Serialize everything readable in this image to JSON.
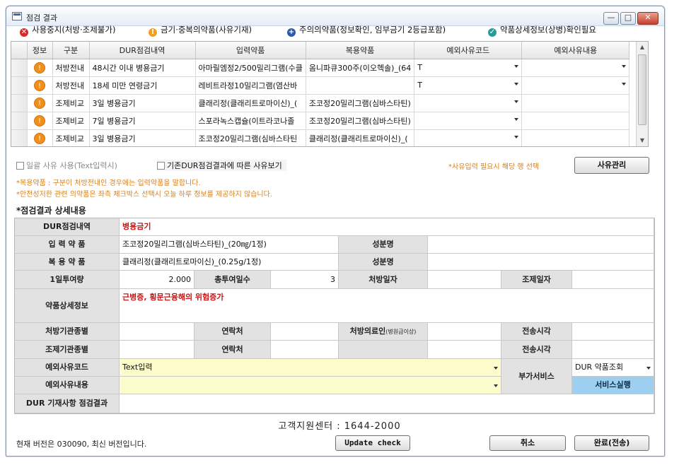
{
  "window": {
    "title": "점검 결과",
    "minimize": "—",
    "maximize": "□",
    "close": "✕"
  },
  "legend": [
    {
      "icon": "stop-icon",
      "glyph": "✕",
      "color": "#d8282a",
      "label": "사용중지(처방·조제불가)"
    },
    {
      "icon": "warning-icon",
      "glyph": "!",
      "color": "#f0a020",
      "label": "금기·중복의약품(사유기재)"
    },
    {
      "icon": "plus-icon",
      "glyph": "+",
      "color": "#2a5ab0",
      "label": "주의의약품(정보확인, 임부금기 2등급포함)"
    },
    {
      "icon": "check-icon",
      "glyph": "✓",
      "color": "#2a9a9a",
      "label": "약품상세정보(상병)확인필요"
    }
  ],
  "grid": {
    "headers": [
      "정보",
      "구분",
      "DUR점검내역",
      "입력약품",
      "복용약품",
      "예외사유코드",
      "예외사유내용"
    ],
    "rows": [
      {
        "type": "처방전내",
        "dur": "48시간 이내 병용금기",
        "input": "아마릴엠정2/500밀리그램(수클",
        "taking": "옴니파큐300주(이오헥솔)_(64",
        "code": "T",
        "reason": ""
      },
      {
        "type": "처방전내",
        "dur": "18세 미만 연령금기",
        "input": "레비트라정10밀리그램(염산바",
        "taking": "",
        "code": "T",
        "reason": ""
      },
      {
        "type": "조제비교",
        "dur": "3일 병용금기",
        "input": "클래리정(클래리트로마이신)_(",
        "taking": "조코정20밀리그램(심바스타틴)",
        "code": "",
        "reason": ""
      },
      {
        "type": "조제비교",
        "dur": "7일 병용금기",
        "input": "스포라녹스캡슐(이트라코나졸",
        "taking": "조코정20밀리그램(심바스타틴)",
        "code": "",
        "reason": ""
      },
      {
        "type": "조제비교",
        "dur": "3일 병용금기",
        "input": "조코정20밀리그램(심바스타틴",
        "taking": "클래리정(클래리트로마이신)_(",
        "code": "",
        "reason": ""
      }
    ]
  },
  "options": {
    "bulk_reason": "일괄 사유 사용(Text입력시)",
    "prev_reason": "기존DUR점검결과에 따른 사유보기",
    "hint": "*사유입력 필요시 해당 행 선택",
    "manage_button": "사유관리"
  },
  "notes": [
    "*복용약품 : 구분이 처방전내인 경우에는 입력약품을 말합니다.",
    "*안전성저한 관련 의약품은 좌측 체크박스 선택시 오늘 하루 정보를 제공하지 않습니다."
  ],
  "detail": {
    "section_title": "*점검결과 상세내용",
    "dur_label": "DUR점검내역",
    "dur_value": "병용금기",
    "input_label": "입 력 약 품",
    "input_value": "조코정20밀리그램(심바스타틴)_(20㎎/1정)",
    "ingredient_label": "성분명",
    "ingredient_value": "",
    "taking_label": "복 용 약 품",
    "taking_value": "클래리정(클래리트로마이신)_(0.25g/1정)",
    "ingredient2_label": "성분명",
    "ingredient2_value": "",
    "daily_label": "1일투여량",
    "daily_value": "2.000",
    "total_days_label": "총투여일수",
    "total_days_value": "3",
    "rx_date_label": "처방일자",
    "rx_date_value": "",
    "dispense_date_label": "조제일자",
    "dispense_date_value": "",
    "drug_info_label": "약품상세정보",
    "drug_info_value": "근병증, 횡문근융해의 위험증가",
    "rx_org_label": "처방기관종별",
    "rx_org_value": "",
    "contact_label": "연락처",
    "contact_value": "",
    "rx_doctor_label": "처방의료인",
    "rx_doctor_sub": "(병원급이상)",
    "rx_doctor_value": "",
    "send_time_label": "전송시각",
    "send_time_value": "",
    "dispense_org_label": "조제기관종별",
    "dispense_org_value": "",
    "contact2_label": "연락처",
    "contact2_value": "",
    "blank_value": "",
    "send_time2_label": "전송시각",
    "send_time2_value": "",
    "exc_code_label": "예외사유코드",
    "exc_code_value": "Text입력",
    "exc_reason_label": "예외사유내용",
    "exc_reason_value": "",
    "addon_label": "부가서비스",
    "addon_select": "DUR 약품조회",
    "service_button": "서비스실행",
    "dur_result_label": "DUR 기재사항 점검결과",
    "dur_result_value": ""
  },
  "footer": {
    "support": "고객지원센터 : 1644-2000",
    "version": "현재 버전은 030090, 최신 버전입니다.",
    "update_button": "Update check",
    "cancel_button": "취소",
    "complete_button": "완료(전송)"
  }
}
